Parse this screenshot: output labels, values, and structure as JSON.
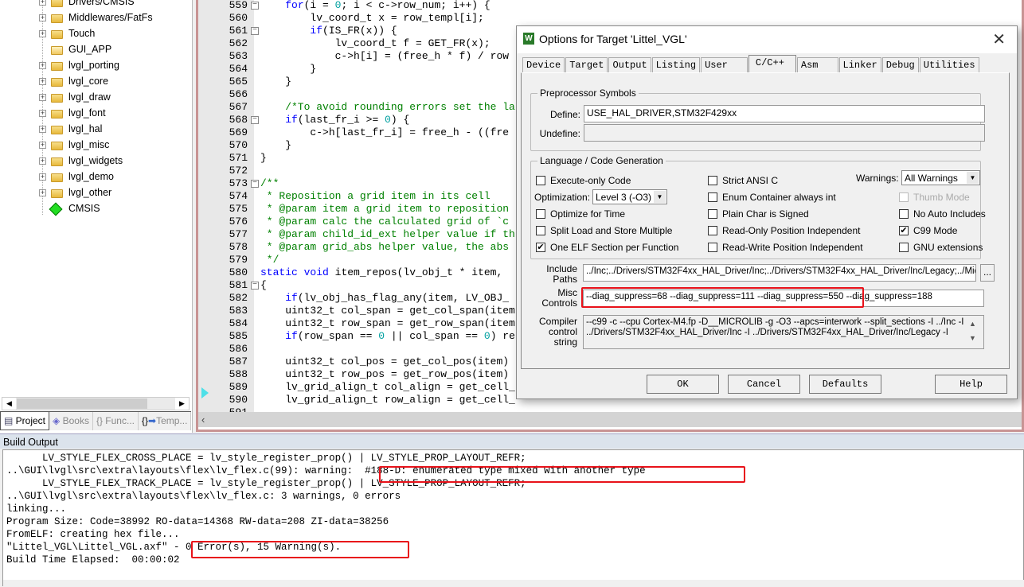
{
  "project_tree": {
    "items": [
      {
        "label": "Drivers/CMSIS",
        "icon": "folder",
        "expandable": true
      },
      {
        "label": "Middlewares/FatFs",
        "icon": "folder",
        "expandable": true
      },
      {
        "label": "Touch",
        "icon": "folder",
        "expandable": true
      },
      {
        "label": "GUI_APP",
        "icon": "folder-open",
        "expandable": false
      },
      {
        "label": "lvgl_porting",
        "icon": "folder",
        "expandable": true
      },
      {
        "label": "lvgl_core",
        "icon": "folder",
        "expandable": true
      },
      {
        "label": "lvgl_draw",
        "icon": "folder",
        "expandable": true
      },
      {
        "label": "lvgl_font",
        "icon": "folder",
        "expandable": true
      },
      {
        "label": "lvgl_hal",
        "icon": "folder",
        "expandable": true
      },
      {
        "label": "lvgl_misc",
        "icon": "folder",
        "expandable": true
      },
      {
        "label": "lvgl_widgets",
        "icon": "folder",
        "expandable": true
      },
      {
        "label": "lvgl_demo",
        "icon": "folder",
        "expandable": true
      },
      {
        "label": "lvgl_other",
        "icon": "folder",
        "expandable": true
      },
      {
        "label": "CMSIS",
        "icon": "green-diamond",
        "expandable": false
      }
    ]
  },
  "panel_tabs": [
    {
      "label": "Project",
      "active": true
    },
    {
      "label": "Books"
    },
    {
      "label": "{} Func..."
    },
    {
      "label": "Temp..."
    }
  ],
  "editor": {
    "lines": [
      {
        "num": "559",
        "text": "    for(i = 0; i < c->row_num; i++) {",
        "fold": true
      },
      {
        "num": "560",
        "text": "        lv_coord_t x = row_templ[i];"
      },
      {
        "num": "561",
        "text": "        if(IS_FR(x)) {",
        "fold": true
      },
      {
        "num": "562",
        "text": "            lv_coord_t f = GET_FR(x);"
      },
      {
        "num": "563",
        "text": "            c->h[i] = (free_h * f) / row"
      },
      {
        "num": "564",
        "text": "        }"
      },
      {
        "num": "565",
        "text": "    }"
      },
      {
        "num": "566",
        "text": ""
      },
      {
        "num": "567",
        "text": "    /*To avoid rounding errors set the la",
        "comment": true
      },
      {
        "num": "568",
        "text": "    if(last_fr_i >= 0) {",
        "fold": true
      },
      {
        "num": "569",
        "text": "        c->h[last_fr_i] = free_h - ((fre"
      },
      {
        "num": "570",
        "text": "    }"
      },
      {
        "num": "571",
        "text": "}"
      },
      {
        "num": "572",
        "text": ""
      },
      {
        "num": "573",
        "text": "/**",
        "comment": true,
        "fold": true
      },
      {
        "num": "574",
        "text": " * Reposition a grid item in its cell",
        "comment": true
      },
      {
        "num": "575",
        "text": " * @param item a grid item to reposition",
        "comment": true
      },
      {
        "num": "576",
        "text": " * @param calc the calculated grid of `c",
        "comment": true
      },
      {
        "num": "577",
        "text": " * @param child_id_ext helper value if th",
        "comment": true
      },
      {
        "num": "578",
        "text": " * @param grid_abs helper value, the abs",
        "comment": true
      },
      {
        "num": "579",
        "text": " */",
        "comment": true
      },
      {
        "num": "580",
        "text": "static void item_repos(lv_obj_t * item, "
      },
      {
        "num": "581",
        "text": "{",
        "fold": true
      },
      {
        "num": "582",
        "text": "    if(lv_obj_has_flag_any(item, LV_OBJ_"
      },
      {
        "num": "583",
        "text": "    uint32_t col_span = get_col_span(item"
      },
      {
        "num": "584",
        "text": "    uint32_t row_span = get_row_span(item"
      },
      {
        "num": "585",
        "text": "    if(row_span == 0 || col_span == 0) re"
      },
      {
        "num": "586",
        "text": ""
      },
      {
        "num": "587",
        "text": "    uint32_t col_pos = get_col_pos(item)"
      },
      {
        "num": "588",
        "text": "    uint32_t row_pos = get_row_pos(item)"
      },
      {
        "num": "589",
        "text": "    lv_grid_align_t col_align = get_cell_"
      },
      {
        "num": "590",
        "text": "    lv_grid_align_t row_align = get_cell_"
      },
      {
        "num": "591",
        "text": ""
      }
    ]
  },
  "build_output": {
    "title": "Build Output",
    "lines": [
      "      LV_STYLE_FLEX_CROSS_PLACE = lv_style_register_prop() | LV_STYLE_PROP_LAYOUT_REFR;",
      "..\\GUI\\lvgl\\src\\extra\\layouts\\flex\\lv_flex.c(99): warning:  #188-D: enumerated type mixed with another type",
      "      LV_STYLE_FLEX_TRACK_PLACE = lv_style_register_prop() | LV_STYLE_PROP_LAYOUT_REFR;",
      "..\\GUI\\lvgl\\src\\extra\\layouts\\flex\\lv_flex.c: 3 warnings, 0 errors",
      "linking...",
      "Program Size: Code=38992 RO-data=14368 RW-data=208 ZI-data=38256",
      "FromELF: creating hex file...",
      "\"Littel_VGL\\Littel_VGL.axf\" - 0 Error(s), 15 Warning(s).",
      "Build Time Elapsed:  00:00:02"
    ]
  },
  "dialog": {
    "title": "Options for Target 'Littel_VGL'",
    "tabs": [
      {
        "label": "Device"
      },
      {
        "label": "Target"
      },
      {
        "label": "Output"
      },
      {
        "label": "Listing"
      },
      {
        "label": "User"
      },
      {
        "label": "C/C++",
        "active": true
      },
      {
        "label": "Asm"
      },
      {
        "label": "Linker"
      },
      {
        "label": "Debug"
      },
      {
        "label": "Utilities"
      }
    ],
    "preprocessor": {
      "group_label": "Preprocessor Symbols",
      "define_label": "Define:",
      "define_value": "USE_HAL_DRIVER,STM32F429xx",
      "undefine_label": "Undefine:",
      "undefine_value": ""
    },
    "language": {
      "group_label": "Language / Code Generation",
      "optimization_label": "Optimization:",
      "optimization_value": "Level 3 (-O3)",
      "warnings_label": "Warnings:",
      "warnings_value": "All Warnings",
      "checkboxes": [
        {
          "label": "Execute-only Code",
          "checked": false
        },
        {
          "label": "Optimize for Time",
          "checked": false
        },
        {
          "label": "Split Load and Store Multiple",
          "checked": false
        },
        {
          "label": "One ELF Section per Function",
          "checked": true
        },
        {
          "label": "Strict ANSI C",
          "checked": false
        },
        {
          "label": "Enum Container always int",
          "checked": false
        },
        {
          "label": "Plain Char is Signed",
          "checked": false
        },
        {
          "label": "Read-Only Position Independent",
          "checked": false
        },
        {
          "label": "Read-Write Position Independent",
          "checked": false
        },
        {
          "label": "Thumb Mode",
          "checked": false,
          "disabled": true
        },
        {
          "label": "No Auto Includes",
          "checked": false
        },
        {
          "label": "C99 Mode",
          "checked": true
        },
        {
          "label": "GNU extensions",
          "checked": false
        }
      ]
    },
    "include_paths_label": "Include Paths",
    "include_paths_value": "../Inc;../Drivers/STM32F4xx_HAL_Driver/Inc;../Drivers/STM32F4xx_HAL_Driver/Inc/Legacy;../Mid",
    "browse_label": "...",
    "misc_controls_label": "Misc Controls",
    "misc_controls_value": "--diag_suppress=68 --diag_suppress=111 --diag_suppress=550 --diag_suppress=188",
    "compiler_string_label": "Compiler control string",
    "compiler_string_value": "--c99 -c --cpu Cortex-M4.fp -D__MICROLIB -g -O3 --apcs=interwork --split_sections -I ../Inc -I ../Drivers/STM32F4xx_HAL_Driver/Inc -I ../Drivers/STM32F4xx_HAL_Driver/Inc/Legacy -I",
    "buttons": {
      "ok": "OK",
      "cancel": "Cancel",
      "defaults": "Defaults",
      "help": "Help"
    }
  },
  "colors": {
    "highlight_box": "#e8121a",
    "keyword": "#0000ff",
    "comment": "#008000",
    "number": "#00a0a0"
  }
}
